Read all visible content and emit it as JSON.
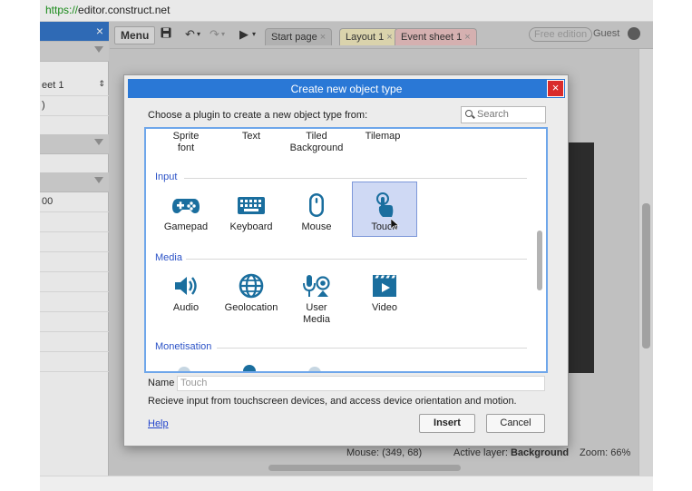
{
  "browser": {
    "url_scheme": "https://",
    "url_rest": "editor.construct.net"
  },
  "left_panel": {
    "row1": "eet 1",
    "row2": ")",
    "row3": "00"
  },
  "toolbar": {
    "menu_label": "Menu",
    "tabs": [
      {
        "label": "Start page",
        "close": "×"
      },
      {
        "label": "Layout 1",
        "close": "×"
      },
      {
        "label": "Event sheet 1",
        "close": "×"
      }
    ],
    "badge": "Free edition",
    "user": "Guest"
  },
  "status": {
    "mouse": "Mouse: (349, 68)",
    "layer_prefix": "Active layer: ",
    "layer_name": "Background",
    "zoom": "Zoom: 66%"
  },
  "dialog": {
    "title": "Create new object type",
    "close": "×",
    "prompt": "Choose a plugin to create a new object type from:",
    "search_placeholder": "Search",
    "top_row": [
      "Sprite font",
      "Text",
      "Tiled Background",
      "Tilemap"
    ],
    "categories": {
      "input": "Input",
      "media": "Media",
      "monetisation": "Monetisation"
    },
    "input_plugins": [
      {
        "label": "Gamepad",
        "icon": "gamepad-icon"
      },
      {
        "label": "Keyboard",
        "icon": "keyboard-icon"
      },
      {
        "label": "Mouse",
        "icon": "mouse-icon"
      },
      {
        "label": "Touch",
        "icon": "touch-icon",
        "selected": true
      }
    ],
    "media_plugins": [
      {
        "label": "Audio",
        "icon": "speaker-icon"
      },
      {
        "label": "Geolocation",
        "icon": "globe-icon"
      },
      {
        "label": "User Media",
        "icon": "microphone-camera-icon"
      },
      {
        "label": "Video",
        "icon": "video-icon"
      }
    ],
    "name_label": "Name",
    "name_value": "Touch",
    "description": "Recieve input from touchscreen devices, and access device orientation and motion.",
    "help": "Help",
    "insert": "Insert",
    "cancel": "Cancel"
  },
  "colors": {
    "accent": "#2a78d6",
    "icon": "#1a6e9e",
    "category": "#2c53c7",
    "selection": "#cfd9f4"
  }
}
